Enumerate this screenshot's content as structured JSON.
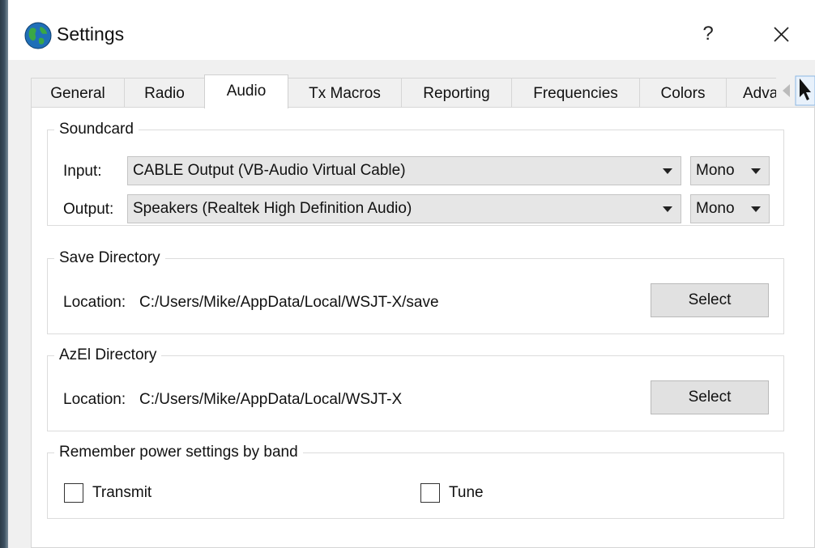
{
  "window": {
    "title": "Settings",
    "help_label": "?"
  },
  "tabs": [
    {
      "label": "General"
    },
    {
      "label": "Radio"
    },
    {
      "label": "Audio"
    },
    {
      "label": "Tx Macros"
    },
    {
      "label": "Reporting"
    },
    {
      "label": "Frequencies"
    },
    {
      "label": "Colors"
    },
    {
      "label": "Advance"
    }
  ],
  "active_tab": "Audio",
  "soundcard": {
    "title": "Soundcard",
    "input": {
      "label": "Input:",
      "device": "CABLE Output (VB-Audio Virtual Cable)",
      "channel": "Mono"
    },
    "output": {
      "label": "Output:",
      "device": "Speakers (Realtek High Definition Audio)",
      "channel": "Mono"
    }
  },
  "save_directory": {
    "title": "Save Directory",
    "location_label": "Location:",
    "path": "C:/Users/Mike/AppData/Local/WSJT-X/save",
    "button": "Select"
  },
  "azel_directory": {
    "title": "AzEl Directory",
    "location_label": "Location:",
    "path": "C:/Users/Mike/AppData/Local/WSJT-X",
    "button": "Select"
  },
  "power_settings": {
    "title": "Remember power settings by band",
    "transmit": {
      "label": "Transmit",
      "checked": false
    },
    "tune": {
      "label": "Tune",
      "checked": false
    }
  },
  "colors": {
    "app_icon_blue": "#1f6fb8",
    "app_icon_green": "#3aa845"
  }
}
